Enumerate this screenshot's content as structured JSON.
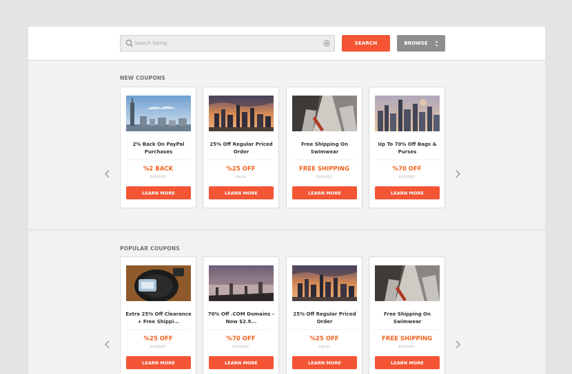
{
  "search": {
    "placeholder": "Search listing",
    "button_label": "SEARCH"
  },
  "browse": {
    "label": "BROWSE"
  },
  "colors": {
    "accent": "#f35535",
    "deal_text": "#f0621e",
    "browse_bg": "#8e8e8e"
  },
  "sections": [
    {
      "title": "NEW COUPONS",
      "cards": [
        {
          "image": "city-skyline-day",
          "title": "2% Back On PayPal Purchases",
          "deal": "%2 BACK",
          "status": "EXPIRED",
          "button": "LEARN MORE"
        },
        {
          "image": "city-skyline-sunset",
          "title": "25% Off Regular Priced Order",
          "deal": "%25 OFF",
          "status": "VALID",
          "button": "LEARN MORE"
        },
        {
          "image": "snowy-street",
          "title": "Free Shipping On Swimwear",
          "deal": "FREE SHIPPING",
          "status": "EXPIRED",
          "button": "LEARN MORE"
        },
        {
          "image": "city-aerial-dusk",
          "title": "Up To 70% Off Bags & Purses",
          "deal": "%70 OFF",
          "status": "EXPIRED",
          "button": "LEARN MORE"
        }
      ]
    },
    {
      "title": "POPULAR COUPONS",
      "cards": [
        {
          "image": "camera-gear",
          "title": "Extra 25% Off Clearance + Free Shippi...",
          "deal": "%25 OFF",
          "status": "EXPIRED",
          "button": "LEARN MORE"
        },
        {
          "image": "waterfront-city",
          "title": "70% Off .COM Domains – Now $2.9...",
          "deal": "%70 OFF",
          "status": "EXPIRED",
          "button": "LEARN MORE"
        },
        {
          "image": "city-skyline-sunset",
          "title": "25% Off Regular Priced Order",
          "deal": "%25 OFF",
          "status": "VALID",
          "button": "LEARN MORE"
        },
        {
          "image": "snowy-street",
          "title": "Free Shipping On Swimwear",
          "deal": "FREE SHIPPING",
          "status": "EXPIRED",
          "button": "LEARN MORE"
        }
      ]
    }
  ]
}
